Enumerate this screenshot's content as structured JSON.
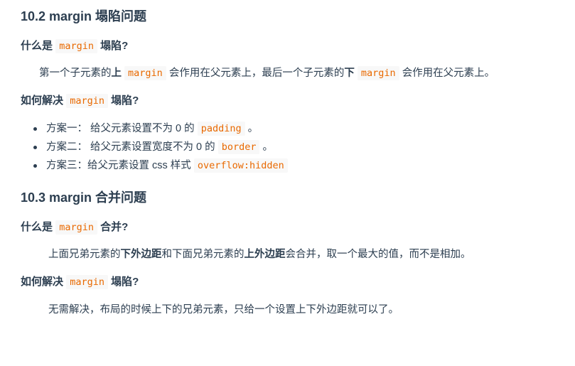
{
  "section1": {
    "title": "10.2 margin 塌陷问题",
    "q1": {
      "prefix": "什么是",
      "code": "margin",
      "suffix": "塌陷?"
    },
    "p1": {
      "t1": "第一个子元素的",
      "b1": "上",
      "code1": "margin",
      "t2": "会作用在父元素上，最后一个子元素的",
      "b2": "下",
      "code2": "margin",
      "t3": "会作用在父元素上。"
    },
    "q2": {
      "prefix": "如何解决",
      "code": "margin",
      "suffix": "塌陷?"
    },
    "items": [
      {
        "text": "方案一： 给父元素设置不为 0 的",
        "code": "padding",
        "tail": "。"
      },
      {
        "text": "方案二： 给父元素设置宽度不为 0 的",
        "code": "border",
        "tail": "。"
      },
      {
        "text": "方案三：给父元素设置 css 样式",
        "code": "overflow:hidden",
        "tail": ""
      }
    ]
  },
  "section2": {
    "title": "10.3 margin 合并问题",
    "q1": {
      "prefix": "什么是",
      "code": "margin",
      "suffix": "合并?"
    },
    "p1": {
      "t1": "上面兄弟元素的",
      "b1": "下外边距",
      "t2": "和下面兄弟元素的",
      "b2": "上外边距",
      "t3": "会合并，取一个最大的值，而不是相加。"
    },
    "q2": {
      "prefix": "如何解决",
      "code": "margin",
      "suffix": "塌陷?"
    },
    "p2": "无需解决，布局的时候上下的兄弟元素，只给一个设置上下外边距就可以了。"
  }
}
